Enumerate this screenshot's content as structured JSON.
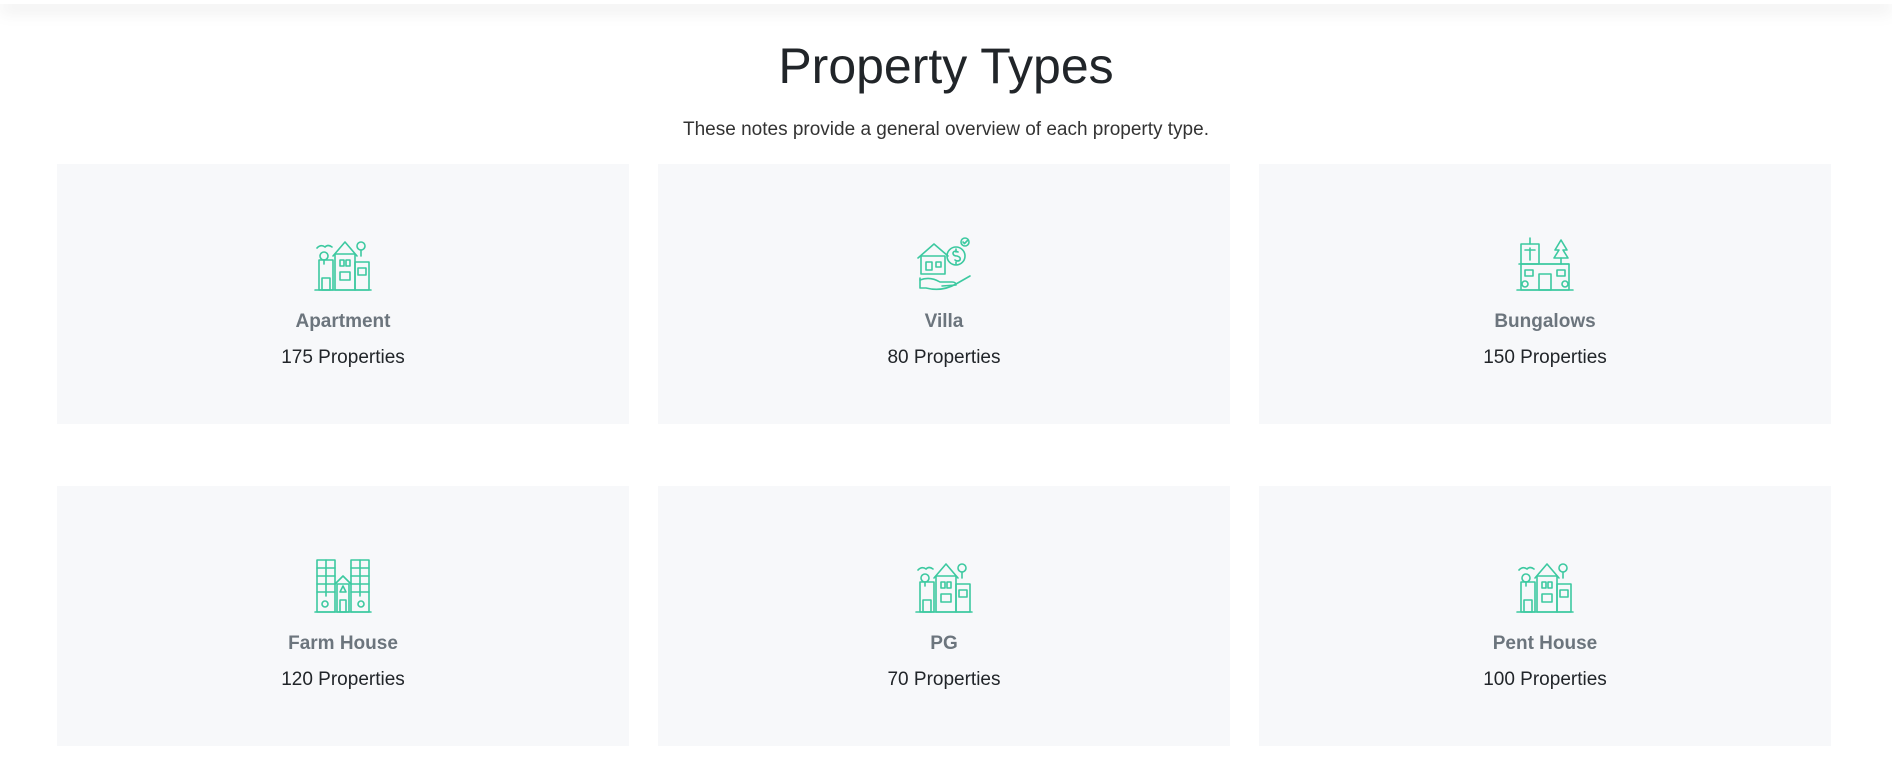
{
  "section": {
    "title": "Property Types",
    "subtitle": "These notes provide a general overview of each property type."
  },
  "accent_color": "#3cc9a0",
  "cards": [
    {
      "name": "Apartment",
      "count": "175 Properties",
      "icon": "apartment-icon"
    },
    {
      "name": "Villa",
      "count": "80 Properties",
      "icon": "villa-icon"
    },
    {
      "name": "Bungalows",
      "count": "150 Properties",
      "icon": "bungalow-icon"
    },
    {
      "name": "Farm House",
      "count": "120 Properties",
      "icon": "farm-house-icon"
    },
    {
      "name": "PG",
      "count": "70 Properties",
      "icon": "pg-icon"
    },
    {
      "name": "Pent House",
      "count": "100 Properties",
      "icon": "pent-house-icon"
    }
  ]
}
